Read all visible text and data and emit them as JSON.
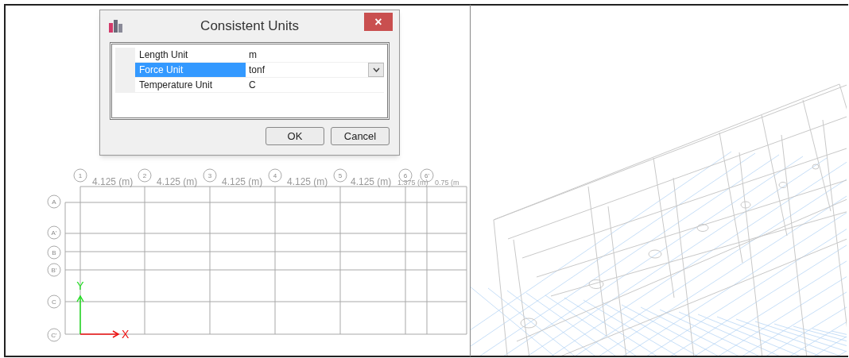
{
  "dialog": {
    "title": "Consistent Units",
    "close": "×",
    "properties": [
      {
        "name": "Length Unit",
        "value": "m",
        "selected": false
      },
      {
        "name": "Force Unit",
        "value": "tonf",
        "selected": true
      },
      {
        "name": "Temperature Unit",
        "value": "C",
        "selected": false
      }
    ],
    "buttons": [
      "OK",
      "Cancel"
    ]
  },
  "plan_view": {
    "column_bubbles": [
      "1",
      "2",
      "3",
      "4",
      "5",
      "6",
      "6'"
    ],
    "column_spacings": [
      "4.125 (m)",
      "4.125 (m)",
      "4.125 (m)",
      "4.125 (m)",
      "4.125 (m)",
      "1.375 (m)",
      "0.75 (m"
    ],
    "row_bubbles": [
      "A",
      "A'",
      "B",
      "B'",
      "C",
      "C'"
    ],
    "axes": {
      "x": "X",
      "y": "Y"
    }
  }
}
